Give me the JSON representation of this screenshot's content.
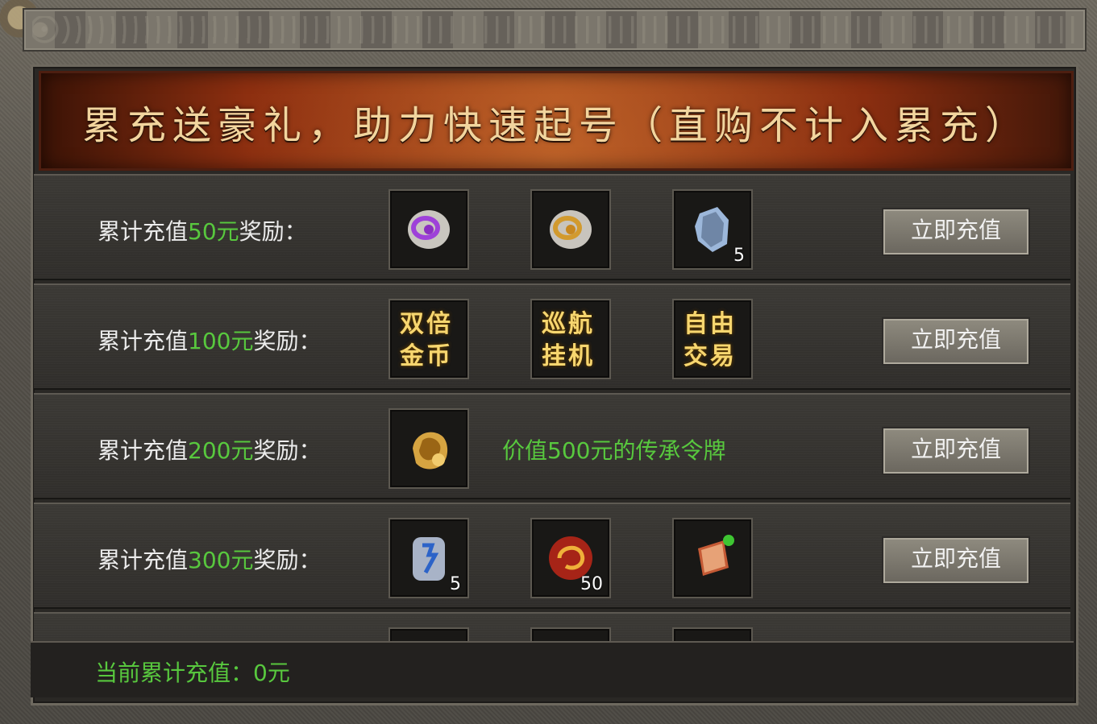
{
  "banner": {
    "title": "累充送豪礼，助力快速起号（直购不计入累充）"
  },
  "rows": [
    {
      "label_prefix": "累计充值",
      "amount": "50元",
      "label_suffix": "奖励：",
      "button_label": "立即充值",
      "slots": [
        {
          "icon": "purple-rune-stone-icon",
          "count": ""
        },
        {
          "icon": "gold-rune-stone-icon",
          "count": ""
        },
        {
          "icon": "blue-crystal-ore-icon",
          "count": "5"
        }
      ]
    },
    {
      "label_prefix": "累计充值",
      "amount": "100元",
      "label_suffix": "奖励：",
      "button_label": "立即充值",
      "slots": [
        {
          "icon": "gold-text-tile-icon",
          "text": "双倍金币",
          "count": ""
        },
        {
          "icon": "gold-text-tile-icon",
          "text": "巡航挂机",
          "count": ""
        },
        {
          "icon": "gold-text-tile-icon",
          "text": "自由交易",
          "count": ""
        }
      ]
    },
    {
      "label_prefix": "累计充值",
      "amount": "200元",
      "label_suffix": "奖励：",
      "button_label": "立即充值",
      "reward_text": "价值500元的传承令牌",
      "slots": [
        {
          "icon": "golden-token-icon",
          "count": ""
        }
      ]
    },
    {
      "label_prefix": "累计充值",
      "amount": "300元",
      "label_suffix": "奖励：",
      "button_label": "立即充值",
      "slots": [
        {
          "icon": "blue-rune-tablet-icon",
          "count": "5"
        },
        {
          "icon": "red-dragon-orb-icon",
          "count": "50"
        },
        {
          "icon": "red-skill-book-icon",
          "count": ""
        }
      ]
    }
  ],
  "footer": {
    "label_prefix": "当前累计充值：",
    "amount": "0元"
  }
}
